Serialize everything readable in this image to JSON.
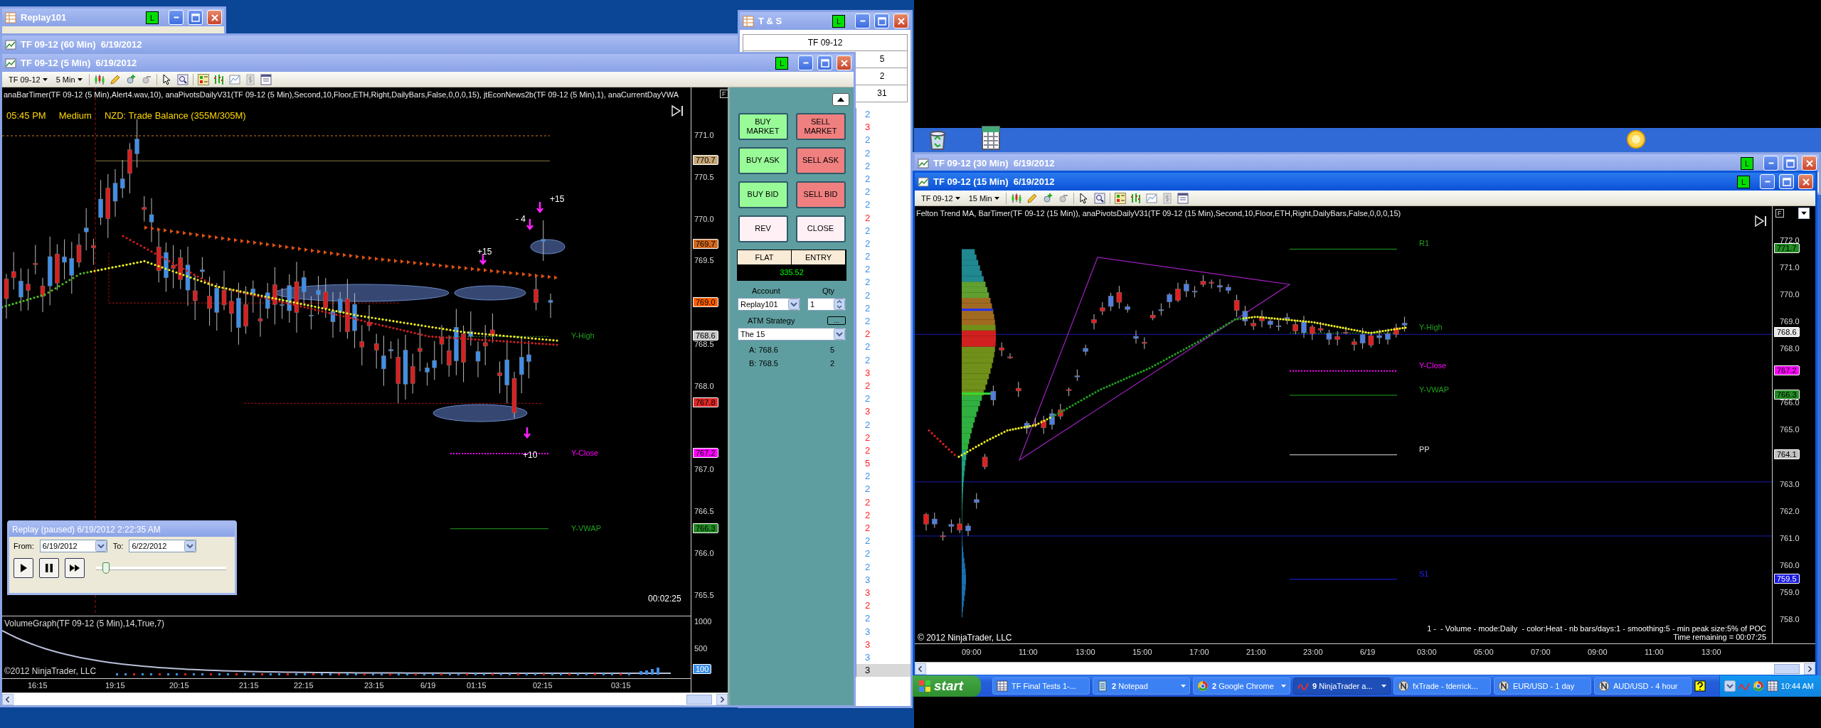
{
  "replay_account_window": {
    "title": "Replay101",
    "active": false,
    "badge": "L"
  },
  "chart_60min_window": {
    "title": "TF 09-12 (60 Min)  6/19/2012",
    "active": false
  },
  "time_sales_window": {
    "title": "T & S",
    "active": false,
    "badge": "L",
    "instrument": "TF 09-12",
    "rows": [
      {
        "value": "5"
      },
      {
        "value": "2"
      },
      {
        "value": "31"
      }
    ],
    "ticks": [
      {
        "size": "2",
        "color": "#3a8ee8",
        "selected": false
      },
      {
        "size": "3",
        "color": "#ff2020",
        "selected": false
      },
      {
        "size": "2",
        "color": "#3a8ee8",
        "selected": false
      },
      {
        "size": "2",
        "color": "#3a8ee8",
        "selected": false
      },
      {
        "size": "2",
        "color": "#3a8ee8",
        "selected": false
      },
      {
        "size": "2",
        "color": "#3a8ee8",
        "selected": false
      },
      {
        "size": "2",
        "color": "#3a8ee8",
        "selected": false
      },
      {
        "size": "2",
        "color": "#3a8ee8",
        "selected": false
      },
      {
        "size": "2",
        "color": "#ff2020",
        "selected": false
      },
      {
        "size": "2",
        "color": "#3a8ee8",
        "selected": false
      },
      {
        "size": "2",
        "color": "#3a8ee8",
        "selected": false
      },
      {
        "size": "2",
        "color": "#3a8ee8",
        "selected": false
      },
      {
        "size": "2",
        "color": "#3a8ee8",
        "selected": false
      },
      {
        "size": "2",
        "color": "#3a8ee8",
        "selected": false
      },
      {
        "size": "2",
        "color": "#3a8ee8",
        "selected": false
      },
      {
        "size": "2",
        "color": "#3a8ee8",
        "selected": false
      },
      {
        "size": "2",
        "color": "#3a8ee8",
        "selected": false
      },
      {
        "size": "2",
        "color": "#ff2020",
        "selected": false
      },
      {
        "size": "2",
        "color": "#3a8ee8",
        "selected": false
      },
      {
        "size": "2",
        "color": "#3a8ee8",
        "selected": false
      },
      {
        "size": "3",
        "color": "#ff2020",
        "selected": false
      },
      {
        "size": "2",
        "color": "#ff2020",
        "selected": false
      },
      {
        "size": "2",
        "color": "#3a8ee8",
        "selected": false
      },
      {
        "size": "3",
        "color": "#ff2020",
        "selected": false
      },
      {
        "size": "2",
        "color": "#3a8ee8",
        "selected": false
      },
      {
        "size": "2",
        "color": "#ff2020",
        "selected": false
      },
      {
        "size": "2",
        "color": "#ff2020",
        "selected": false
      },
      {
        "size": "5",
        "color": "#ff2020",
        "selected": false
      },
      {
        "size": "2",
        "color": "#3a8ee8",
        "selected": false
      },
      {
        "size": "2",
        "color": "#3a8ee8",
        "selected": false
      },
      {
        "size": "2",
        "color": "#ff2020",
        "selected": false
      },
      {
        "size": "2",
        "color": "#ff2020",
        "selected": false
      },
      {
        "size": "2",
        "color": "#ff2020",
        "selected": false
      },
      {
        "size": "2",
        "color": "#3a8ee8",
        "selected": false
      },
      {
        "size": "2",
        "color": "#3a8ee8",
        "selected": false
      },
      {
        "size": "2",
        "color": "#3a8ee8",
        "selected": false
      },
      {
        "size": "3",
        "color": "#3a8ee8",
        "selected": false
      },
      {
        "size": "3",
        "color": "#ff2020",
        "selected": false
      },
      {
        "size": "2",
        "color": "#ff2020",
        "selected": false
      },
      {
        "size": "2",
        "color": "#3a8ee8",
        "selected": false
      },
      {
        "size": "3",
        "color": "#3a8ee8",
        "selected": false
      },
      {
        "size": "3",
        "color": "#ff2020",
        "selected": false
      },
      {
        "size": "3",
        "color": "#3a8ee8",
        "selected": false
      },
      {
        "size": "3",
        "color": "#000000",
        "selected": true
      }
    ]
  },
  "chart_5min_window": {
    "title": "TF 09-12 (5 Min)  6/19/2012",
    "active": false,
    "badge": "L",
    "toolbar": {
      "instrument": "TF 09-12",
      "interval": "5 Min"
    },
    "indicators": "anaBarTimer(TF 09-12 (5 Min),Alert4.wav,10), anaPivotsDailyV31(TF 09-12 (5 Min),Second,10,Floor,ETH,Right,DailyBars,False,0,0,0,15), jtEconNews2b(TF 09-12 (5 Min),1), anaCurrentDayVWA",
    "news": {
      "time": "05:45 PM",
      "impact": "Medium",
      "event": "NZD: Trade Balance (355M/305M)"
    },
    "flag": "F",
    "price_ticks": [
      "771.0",
      "770.5",
      "770.0",
      "769.5",
      "768.5",
      "768.0",
      "767.0",
      "766.5",
      "766.0",
      "765.5"
    ],
    "price_tags": [
      {
        "text": "770.7",
        "color": "#c8a878"
      },
      {
        "text": "769.7",
        "color": "#d2691e"
      },
      {
        "text": "769.0",
        "color": "#ff6000"
      },
      {
        "text": "768.6",
        "color": "#c8c8c8"
      },
      {
        "text": "767.8",
        "color": "#e02828"
      },
      {
        "text": "767.2",
        "color": "#ff00ff"
      },
      {
        "text": "766.3",
        "color": "#228b22"
      }
    ],
    "levels": [
      {
        "text": "Y-High",
        "color": "#1fa01f"
      },
      {
        "text": "Y-Close",
        "color": "#ff00ff"
      },
      {
        "text": "Y-VWAP",
        "color": "#1fa01f"
      }
    ],
    "trade_marks": [
      "+15",
      "- 4",
      "+15",
      "+10"
    ],
    "timer": "00:02:25",
    "volume": {
      "label": "VolumeGraph(TF 09-12 (5 Min),14,True,7)",
      "ticks": [
        "1000",
        "500"
      ],
      "tag": "100",
      "copyright": "©2012 NinjaTrader, LLC"
    },
    "time_labels": [
      "16:15",
      "19:15",
      "20:15",
      "21:15",
      "22:15",
      "23:15",
      "6/19",
      "01:15",
      "02:15",
      "03:15"
    ]
  },
  "replay_dialog": {
    "title": "Replay (paused) 6/19/2012 2:22:35 AM",
    "from_label": "From:",
    "from": "6/19/2012",
    "to_label": "To:",
    "to": "6/22/2012",
    "level": 0.05
  },
  "trade_panel": {
    "buttons": [
      {
        "label": "BUY MARKET",
        "kind": "buy"
      },
      {
        "label": "SELL MARKET",
        "kind": "sell"
      },
      {
        "label": "BUY ASK",
        "kind": "buy"
      },
      {
        "label": "SELL ASK",
        "kind": "sell"
      },
      {
        "label": "BUY BID",
        "kind": "buy"
      },
      {
        "label": "SELL BID",
        "kind": "sell"
      },
      {
        "label": "REV",
        "kind": "neutral"
      },
      {
        "label": "CLOSE",
        "kind": "neutral"
      }
    ],
    "position": "FLAT",
    "entry": "ENTRY",
    "pnl": "335.52",
    "account_label": "Account",
    "account": "Replay101",
    "qty_label": "Qty",
    "qty": "1",
    "atm_label": "ATM Strategy",
    "atm_button": "...",
    "atm": "The 15",
    "orders": [
      {
        "label": "A: 768.6",
        "qty": "5"
      },
      {
        "label": "B: 768.5",
        "qty": "2"
      }
    ]
  },
  "chart_30min_window": {
    "title": "TF 09-12 (30 Min)  6/19/2012",
    "active": false,
    "badge": "L"
  },
  "chart_15min_window": {
    "title": "TF 09-12 (15 Min)  6/19/2012",
    "active": true,
    "badge": "L",
    "toolbar": {
      "instrument": "TF 09-12",
      "interval": "15 Min"
    },
    "indicators": "Felton Trend MA, BarTimer(TF 09-12 (15 Min)), anaPivotsDailyV31(TF 09-12 (15 Min),Second,10,Floor,ETH,Right,DailyBars,False,0,0,0,15)",
    "flag": "F",
    "price_ticks": [
      "772.0",
      "771.0",
      "770.0",
      "769.0",
      "768.0",
      "766.0",
      "765.0",
      "763.0",
      "762.0",
      "761.0",
      "760.0",
      "759.0",
      "758.0"
    ],
    "price_tags": [
      {
        "text": "771.7",
        "color": "#228b22"
      },
      {
        "text": "768.6",
        "color": "#e8e8e8"
      },
      {
        "text": "767.2",
        "color": "#ff00ff"
      },
      {
        "text": "766.3",
        "color": "#228b22"
      },
      {
        "text": "764.1",
        "color": "#c0c0c0"
      },
      {
        "text": "759.5",
        "color": "#1a1ae0"
      }
    ],
    "levels": [
      {
        "text": "R1",
        "color": "#1fa01f"
      },
      {
        "text": "Y-High",
        "color": "#1fa01f"
      },
      {
        "text": "Y-Close",
        "color": "#ff00ff"
      },
      {
        "text": "Y-VWAP",
        "color": "#1fa01f"
      },
      {
        "text": "PP",
        "color": "#e0e0e0"
      },
      {
        "text": "S1",
        "color": "#2020ff"
      }
    ],
    "info": [
      "1 -  - Volume - mode:Daily  - color:Heat - nb bars/days:1 - smoothing:5 - min peak size:5% of POC",
      "Time remaining = 00:07:25"
    ],
    "copyright": "© 2012 NinjaTrader, LLC",
    "time_labels": [
      "09:00",
      "11:00",
      "13:00",
      "15:00",
      "17:00",
      "21:00",
      "23:00",
      "6/19",
      "03:00",
      "05:00",
      "07:00",
      "09:00",
      "11:00",
      "13:00"
    ]
  },
  "taskbar": {
    "start": "start",
    "items": [
      {
        "label": "TF Final Tests 1-...",
        "selected": false,
        "grouped": false
      },
      {
        "count": "2",
        "label": "Notepad",
        "selected": false,
        "grouped": true
      },
      {
        "count": "2",
        "label": "Google Chrome",
        "selected": false,
        "grouped": true
      },
      {
        "count": "9",
        "label": "NinjaTrader a...",
        "selected": true,
        "grouped": true
      },
      {
        "label": "fxTrade - tderrick...",
        "selected": false,
        "grouped": false
      },
      {
        "label": "EUR/USD - 1 day",
        "selected": false,
        "grouped": false
      },
      {
        "label": "AUD/USD - 4 hour",
        "selected": false,
        "grouped": false
      }
    ],
    "clock": "10:44 AM"
  }
}
